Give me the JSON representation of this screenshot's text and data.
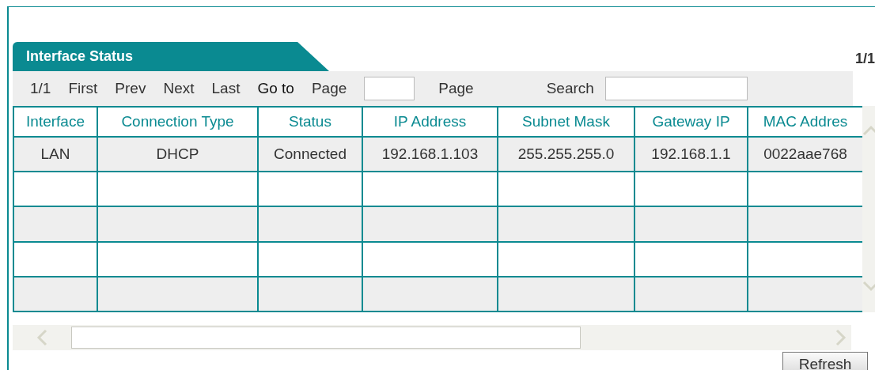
{
  "panel": {
    "title": "Interface Status",
    "page_indicator": "1/1"
  },
  "pager": {
    "current": "1/1",
    "links": [
      "First",
      "Prev",
      "Next",
      "Last"
    ],
    "goto_label": "Go to",
    "page_label_before": "Page",
    "page_label_after": "Page",
    "search_label": "Search"
  },
  "table": {
    "columns": [
      "Interface",
      "Connection Type",
      "Status",
      "IP Address",
      "Subnet Mask",
      "Gateway IP",
      "MAC Addres"
    ],
    "rows": [
      [
        "LAN",
        "DHCP",
        "Connected",
        "192.168.1.103",
        "255.255.255.0",
        "192.168.1.1",
        "0022aae768"
      ]
    ]
  },
  "buttons": [
    "Refresh"
  ]
}
